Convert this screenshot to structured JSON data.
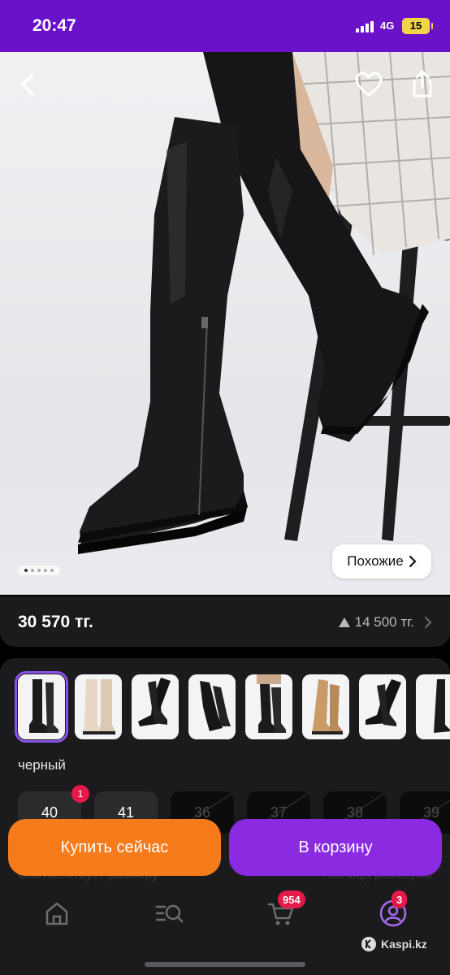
{
  "status_bar": {
    "time": "20:47",
    "network": "4G",
    "battery": "15"
  },
  "product": {
    "image_alt": "",
    "similar_label": "Похожие",
    "slide_count": 5,
    "active_slide": 1
  },
  "price_card": {
    "price": "30 570 тг.",
    "installment": "14 500 тг."
  },
  "variants": {
    "color_label": "черный",
    "thumbnail_count": 8,
    "sizes": [
      {
        "label": "40",
        "available": true,
        "badge": "1"
      },
      {
        "label": "41",
        "available": true,
        "badge": ""
      },
      {
        "label": "36",
        "available": false,
        "badge": ""
      },
      {
        "label": "37",
        "available": false,
        "badge": ""
      },
      {
        "label": "38",
        "available": false,
        "badge": ""
      },
      {
        "label": "39",
        "available": false,
        "badge": ""
      }
    ],
    "faded_left": "Соответствует размеру",
    "faded_right": "Таблица размеров"
  },
  "actions": {
    "buy_now": "Купить сейчас",
    "add_to_cart": "В корзину"
  },
  "nav": {
    "cart_badge": "954",
    "profile_badge": "3"
  },
  "watermark": "Kaspi.kz",
  "colors": {
    "status_bar": "#6a12c9",
    "buy": "#f57b1b",
    "cart": "#8a2be2",
    "badge": "#e51a4a"
  }
}
